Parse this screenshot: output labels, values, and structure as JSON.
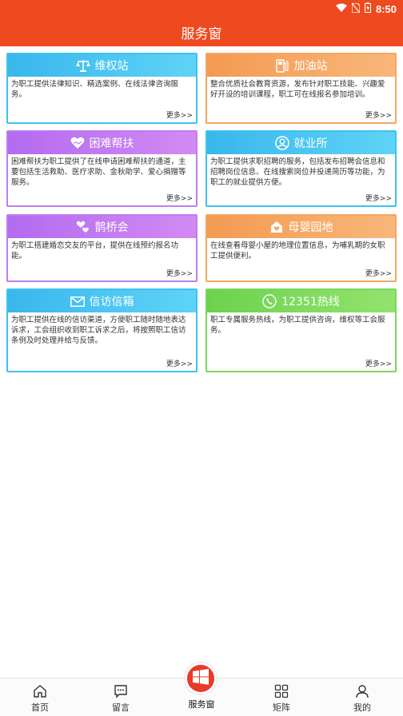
{
  "status": {
    "time": "8:50"
  },
  "header": {
    "title": "服务窗"
  },
  "cards": [
    {
      "title": "维权站",
      "desc": "为职工提供法律知识、精选案例、在线法律咨询服务。",
      "more": "更多>>",
      "icon": "scales-icon"
    },
    {
      "title": "加油站",
      "desc": "整合优质社会教育资源，发布针对职工技能、兴趣爱好开设的培训课程，职工可在线报名参加培训。",
      "more": "更多>>",
      "icon": "fuel-pump-icon"
    },
    {
      "title": "困难帮扶",
      "desc": "困难帮扶为职工提供了在线申请困难帮扶的通道，主要包括生活救助、医疗求助、金秋助学、爱心捐赠等服务。",
      "more": "更多>>",
      "icon": "heart-hand-icon"
    },
    {
      "title": "就业所",
      "desc": "为职工提供求职招聘的服务，包括发布招聘会信息和招聘岗位信息、在线搜索岗位并投递简历等功能，为职工的就业提供方便。",
      "more": "更多>>",
      "icon": "person-search-icon"
    },
    {
      "title": "鹊桥会",
      "desc": "为职工搭建婚恋交友的平台，提供在线预约报名功能。",
      "more": "更多>>",
      "icon": "hearts-icon"
    },
    {
      "title": "母婴园地",
      "desc": "在线查看母婴小屋的地理位置信息，为哺乳期的女职工提供便利。",
      "more": "更多>>",
      "icon": "mother-baby-house-icon"
    },
    {
      "title": "信访信箱",
      "desc": "为职工提供在线的信访渠道，方便职工随时随地表达诉求，工会组织收到职工诉求之后，将按照职工信访条例及时处理并给与反馈。",
      "more": "更多>>",
      "icon": "envelope-icon"
    },
    {
      "title": "12351热线",
      "desc": "职工专属服务热线，为职工提供咨询，维权等工会服务。",
      "more": "更多>>",
      "icon": "phone-icon"
    }
  ],
  "nav": {
    "home": "首页",
    "message": "留言",
    "service": "服务窗",
    "matrix": "矩阵",
    "mine": "我的"
  }
}
